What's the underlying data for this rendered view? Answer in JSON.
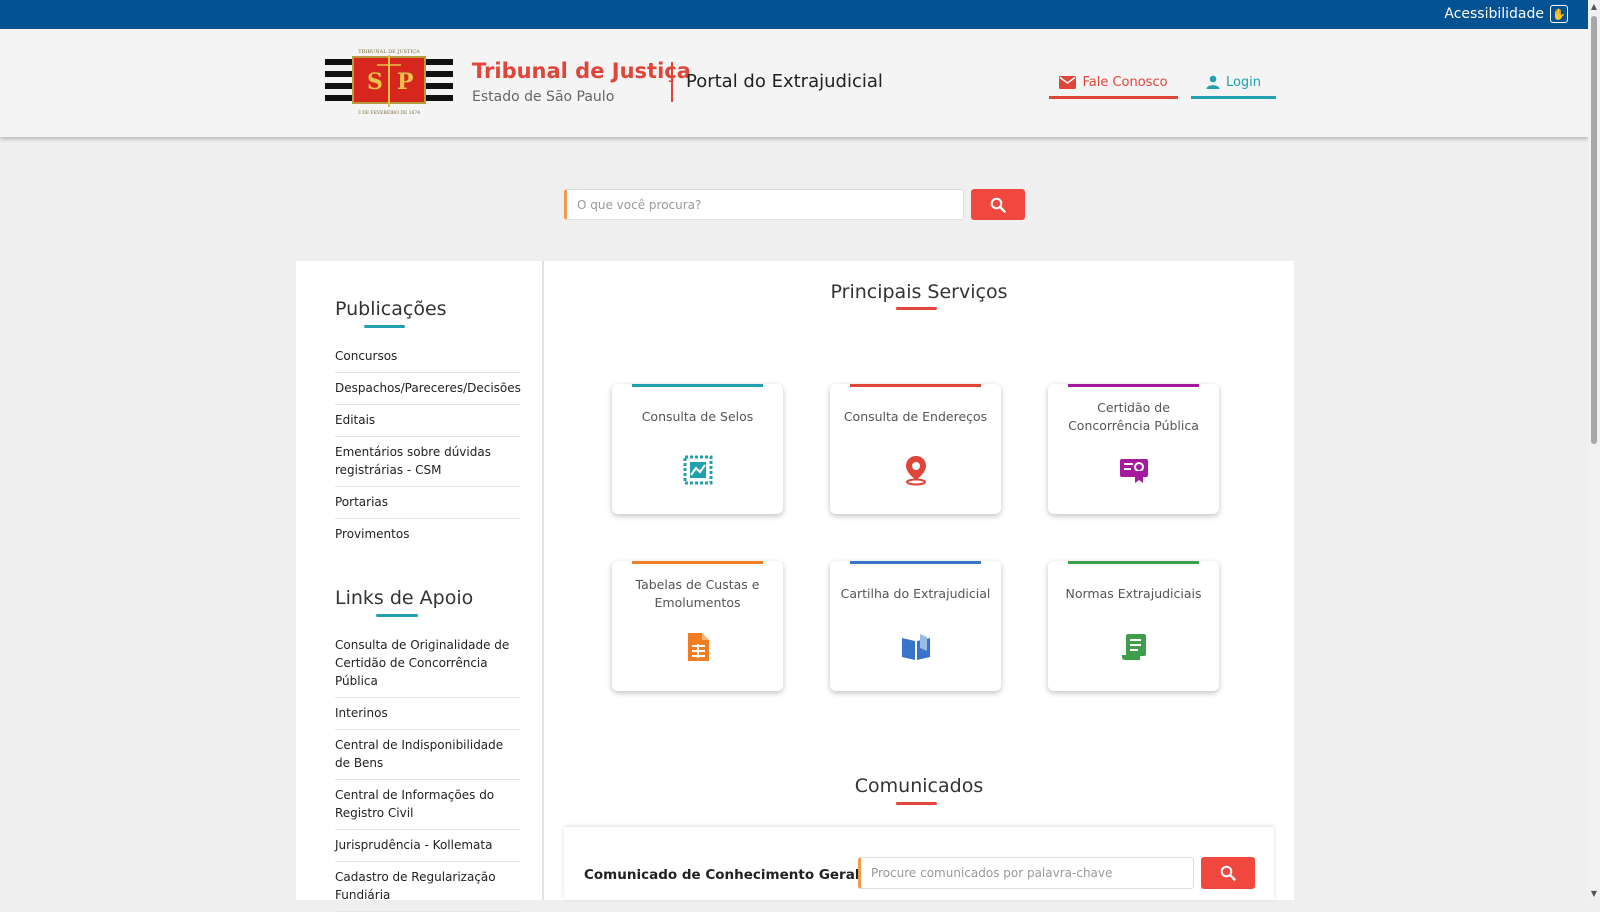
{
  "topbar": {
    "accessibility_label": "Acessibilidade"
  },
  "header": {
    "logo_top_text": "TRIBUNAL DE JUSTIÇA",
    "logo_bottom_text": "3 DE FEVEREIRO DE 1874",
    "logo_letters": [
      "S",
      "P"
    ],
    "title": "Tribunal de Justiça",
    "subtitle": "Estado de São Paulo",
    "portal_name": "Portal do Extrajudicial",
    "contact_label": "Fale Conosco",
    "login_label": "Login"
  },
  "search": {
    "placeholder": "O que você procura?",
    "icon": "search-icon"
  },
  "sidebar": {
    "publicacoes": {
      "title": "Publicações",
      "items": [
        "Concursos",
        "Despachos/Pareceres/Decisões",
        "Editais",
        "Ementários sobre dúvidas registrárias - CSM",
        "Portarias",
        "Provimentos"
      ]
    },
    "links": {
      "title": "Links de Apoio",
      "items": [
        "Consulta de Originalidade de Certidão de Concorrência Pública",
        "Interinos",
        "Central de Indisponibilidade de Bens",
        "Central de Informações do Registro Civil",
        "Jurisprudência - Kollemata",
        "Cadastro de Regularização Fundiária"
      ]
    }
  },
  "services": {
    "title": "Principais Serviços",
    "cards": [
      {
        "label": "Consulta de Selos",
        "color": "#21a1ad",
        "icon": "stamp-icon"
      },
      {
        "label": "Consulta de Endereços",
        "color": "#e0453a",
        "icon": "map-pin-icon"
      },
      {
        "label": "Certidão de Concorrência Pública",
        "color": "#a6199e",
        "icon": "certificate-icon"
      },
      {
        "label": "Tabelas de Custas e Emolumentos",
        "color": "#f07d22",
        "icon": "spreadsheet-icon"
      },
      {
        "label": "Cartilha do Extrajudicial",
        "color": "#3a74c9",
        "icon": "open-book-icon"
      },
      {
        "label": "Normas Extrajudiciais",
        "color": "#3f9d4b",
        "icon": "document-scroll-icon"
      }
    ]
  },
  "comunicados": {
    "title": "Comunicados",
    "label": "Comunicado de Conhecimento Geral",
    "placeholder": "Procure comunicados por palavra-chave"
  },
  "colors": {
    "top_bar": "#035294",
    "accent_red": "#e0453a",
    "accent_teal": "#21a1ad",
    "search_button": "#f0483e"
  }
}
